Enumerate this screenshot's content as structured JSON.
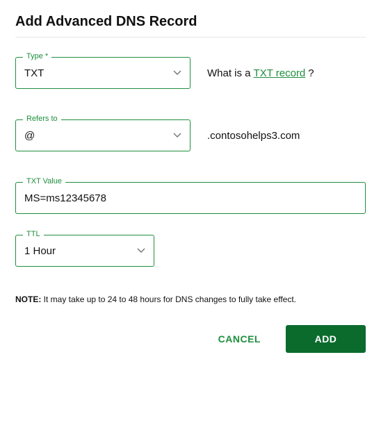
{
  "title": "Add Advanced DNS Record",
  "fields": {
    "type": {
      "label": "Type *",
      "value": "TXT",
      "help_prefix": "What is a ",
      "help_link": "TXT record ",
      "help_suffix": "?"
    },
    "refersTo": {
      "label": "Refers to",
      "value": "@",
      "domain": ".contosohelps3.com"
    },
    "txtValue": {
      "label": "TXT Value",
      "value": "MS=ms12345678"
    },
    "ttl": {
      "label": "TTL",
      "value": "1 Hour"
    }
  },
  "note": {
    "strong": "NOTE:",
    "text": " It may take up to 24 to 48 hours for DNS changes to fully take effect."
  },
  "buttons": {
    "cancel": "CANCEL",
    "add": "ADD"
  }
}
